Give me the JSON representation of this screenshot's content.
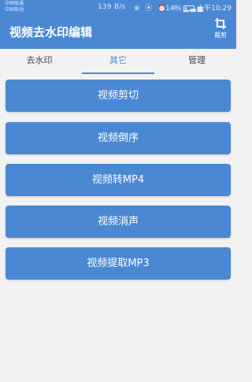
{
  "status_bar": {
    "carrier_1": "中国联通",
    "carrier_2": "中国移动",
    "speed": "139 B/s",
    "icons": "⊕ ⦿ ⏰ ✧ ▂▃▅",
    "battery": "14%",
    "time": "上午10:29"
  },
  "header": {
    "title": "视频去水印编辑",
    "crop_label": "裁剪",
    "color": "#4a88d4"
  },
  "tabs": [
    {
      "label": "去水印"
    },
    {
      "label": "其它",
      "active": true
    },
    {
      "label": "管理"
    }
  ],
  "actions": [
    {
      "label": "视频剪切"
    },
    {
      "label": "视频倒序"
    },
    {
      "label": "视频转MP4"
    },
    {
      "label": "视频消声"
    },
    {
      "label": "视频提取MP3"
    }
  ]
}
